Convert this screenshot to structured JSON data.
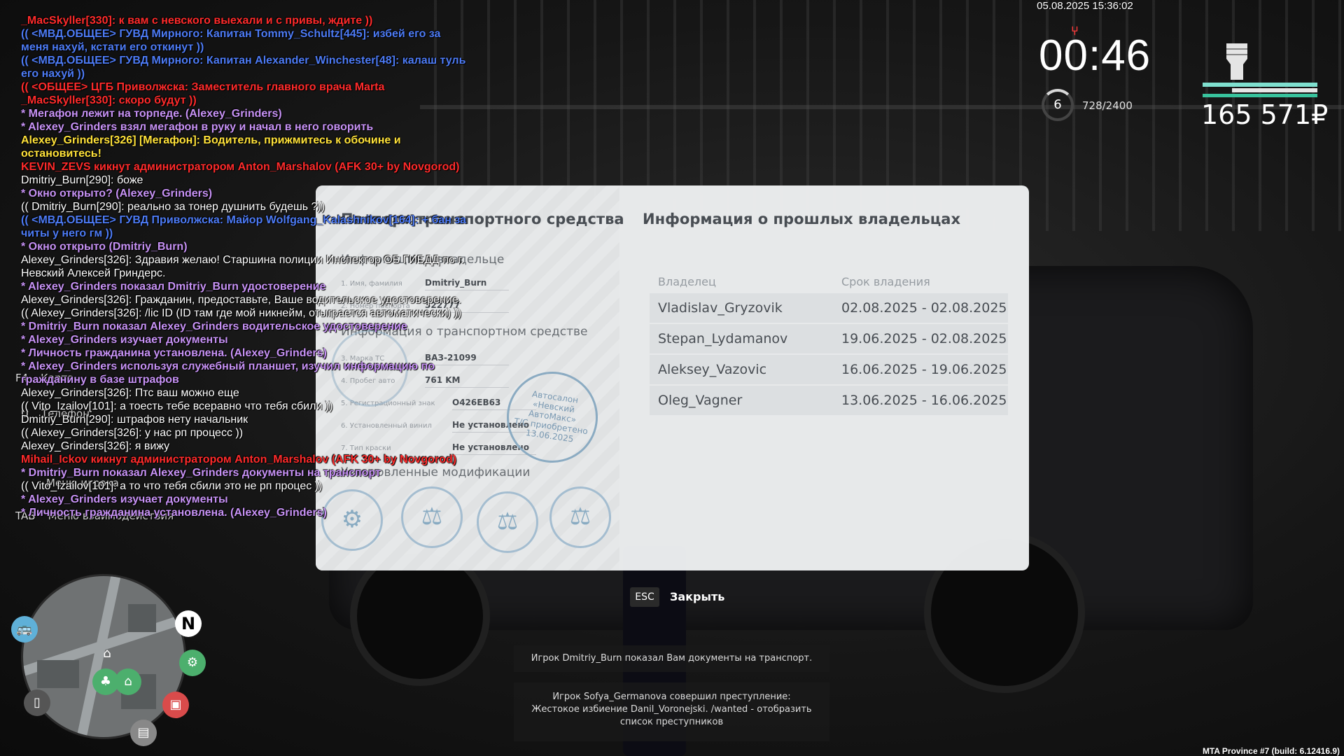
{
  "hud": {
    "datetime": "05.08.2025 15:36:02",
    "timer": "00:46",
    "level": "6",
    "xp": "728/2400",
    "money": "165 571₽"
  },
  "chat": [
    {
      "text": "_MacSkyller[330]: к вам с невского выехали и с привы, ждите ))",
      "color": "red"
    },
    {
      "text": "(( <МВД.ОБЩЕЕ> ГУВД Мирного: Капитан Tommy_Schultz[445]: избей его за меня нахуй, кстати его откинут ))",
      "color": "blue"
    },
    {
      "text": "(( <МВД.ОБЩЕЕ> ГУВД Мирного: Капитан Alexander_Winchester[48]: калаш туль его нахуй ))",
      "color": "blue"
    },
    {
      "text": "(( <ОБЩЕЕ> ЦГБ Приволжска: Заместитель главного врача Marta _MacSkyller[330]: скоро будут ))",
      "color": "red"
    },
    {
      "text": "* Мегафон лежит на торпеде. (Alexey_Grinders)",
      "color": "purple"
    },
    {
      "text": "* Alexey_Grinders взял мегафон в руку и начал в него говорить",
      "color": "purple"
    },
    {
      "text": "Alexey_Grinders[326] [Мегафон]: Водитель, прижмитесь к обочине и остановитесь!",
      "color": "yellow"
    },
    {
      "text": "KEVIN_ZEVS кикнут администратором Anton_Marshalov (AFK 30+ by Novgorod)",
      "color": "red"
    },
    {
      "text": "Dmitriy_Burn[290]: боже",
      "color": "white"
    },
    {
      "text": "* Окно открыто? (Alexey_Grinders)",
      "color": "purple"
    },
    {
      "text": "(( Dmitriy_Burn[290]: реально за тонер душнить будешь ?))",
      "color": "white"
    },
    {
      "text": "(( <МВД.ОБЩЕЕ> ГУВД Приволжска: Майор Wolfgang_Kalashnikov[164]: + бан за читы у него гм ))",
      "color": "blue"
    },
    {
      "text": "* Окно открыто (Dmitriy_Burn)",
      "color": "purple"
    },
    {
      "text": "Alexey_Grinders[326]: Здравия желаю! Старшина полиции Инспектор ОБ ГИБДД по г. Невский Алексей Гриндерс.",
      "color": "white"
    },
    {
      "text": "* Alexey_Grinders показал Dmitriy_Burn удостоверение",
      "color": "purple"
    },
    {
      "text": "Alexey_Grinders[326]: Гражданин, предоставьте, Ваше водительское удостоверение.",
      "color": "white"
    },
    {
      "text": "(( Alexey_Grinders[326]: /lic ID (ID там где мой никнейм, отыграется автоматически) ))",
      "color": "white"
    },
    {
      "text": "* Dmitriy_Burn показал Alexey_Grinders водительское удостоверение",
      "color": "purple"
    },
    {
      "text": "* Alexey_Grinders изучает документы",
      "color": "purple"
    },
    {
      "text": "* Личность гражданина установлена. (Alexey_Grinders)",
      "color": "purple"
    },
    {
      "text": "* Alexey_Grinders используя служебный планшет, изучил информацию по гражданину в базе штрафов",
      "color": "purple"
    },
    {
      "text": "Alexey_Grinders[326]: Птс ваш можно еще",
      "color": "white"
    },
    {
      "text": "(( Vito_Izailov[101]: а тоесть тебе всеравно что тебя сбили ))",
      "color": "white"
    },
    {
      "text": "Dmitriy_Burn[290]: штрафов нету начальник",
      "color": "white"
    },
    {
      "text": "(( Alexey_Grinders[326]: у нас рп процесс ))",
      "color": "white"
    },
    {
      "text": "Alexey_Grinders[326]: я вижу",
      "color": "white"
    },
    {
      "text": "Mihail_Ickov кикнут администратором Anton_Marshalov (AFK 30+ by Novgorod)",
      "color": "red"
    },
    {
      "text": "* Dmitriy_Burn показал Alexey_Grinders документы на транспорт",
      "color": "purple"
    },
    {
      "text": "(( Vito_Izailov[101]: а то что тебя сбили это не рп процес ))",
      "color": "white"
    },
    {
      "text": "* Alexey_Grinders изучает документы",
      "color": "purple"
    },
    {
      "text": "* Личность гражданина установлена. (Alexey_Grinders)",
      "color": "purple"
    }
  ],
  "prompts": {
    "f4_key": "F4",
    "f4_label": "Карта",
    "u_key": "U",
    "u_label": "Телефон",
    "m_label": "Меню игрока",
    "tab_key": "TAB",
    "tab_label": "Меню взаимодействия"
  },
  "document": {
    "left_title": "Паспорт транспортного средства",
    "owner_section": "Информация о владельце",
    "owner_name_label": "1. Имя, фамилия",
    "owner_name": "Dmitriy_Burn",
    "passport_label": "2. Номер паспорта",
    "passport": "322777",
    "vehicle_section": "Информация о транспортном средстве",
    "model_label": "3. Марка ТС",
    "model": "ВАЗ-21099",
    "mileage_label": "4. Пробег авто",
    "mileage": "761 KM",
    "plate_label": "5. Регистрационный знак",
    "plate": "O426EB63",
    "vinyl_label": "6. Установленный винил",
    "vinyl": "Не установлено",
    "paint_label": "7. Тип краски",
    "paint": "Не установлено",
    "mods_section": "Установленные модификации",
    "stamp_line1": "Автосалон",
    "stamp_line2": "«Невский АвтоМакс»",
    "stamp_line3": "Т/С приобретено",
    "stamp_date": "13.06.2025",
    "right_title": "Информация о прошлых владельцах",
    "col_owner": "Владелец",
    "col_period": "Срок владения",
    "owners": [
      {
        "name": "Vladislav_Gryzovik",
        "period": "02.08.2025 - 02.08.2025"
      },
      {
        "name": "Stepan_Lydamanov",
        "period": "19.06.2025 - 02.08.2025"
      },
      {
        "name": "Aleksey_Vazovic",
        "period": "16.06.2025 - 19.06.2025"
      },
      {
        "name": "Oleg_Vagner",
        "period": "13.06.2025 - 16.06.2025"
      }
    ],
    "esc_key": "ESC",
    "close_label": "Закрыть"
  },
  "notices": [
    "Игрок Dmitriy_Burn показал Вам документы на транспорт.",
    "Игрок Sofya_Germanova совершил преступление: Жестокое избиение Danil_Voronejski. /wanted - отобразить список преступников"
  ],
  "build": "MTA Province #7 (build: 6.12416.9)",
  "minimap": {
    "north": "N"
  },
  "colors": {
    "red": "#ff2b2b",
    "blue": "#4d7bf5",
    "purple": "#c792f5",
    "white": "#ffffff",
    "yellow": "#ffe23a",
    "hp": "#38c39d"
  }
}
